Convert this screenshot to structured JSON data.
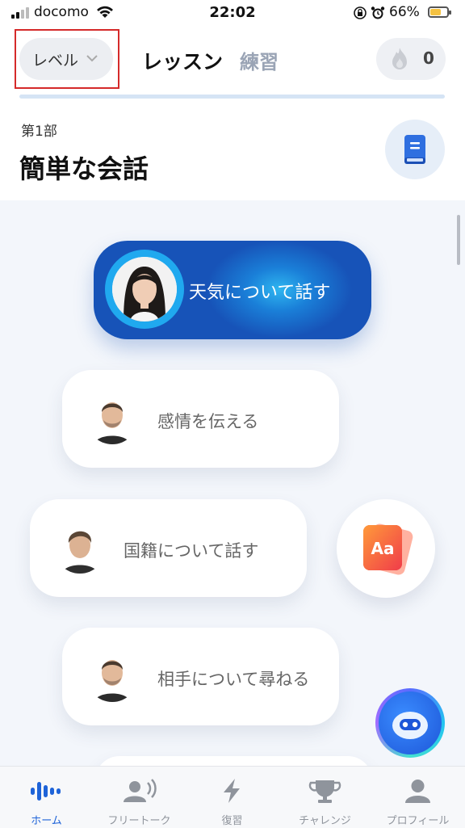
{
  "status_bar": {
    "carrier": "docomo",
    "time": "22:02",
    "battery_percent": "66%",
    "battery_level": 0.66,
    "icons": [
      "signal-icon",
      "wifi-icon",
      "orientation-lock-icon",
      "alarm-icon",
      "battery-icon"
    ]
  },
  "header": {
    "level_label": "レベル",
    "tabs": [
      "レッスン",
      "練習"
    ],
    "active_tab": "レッスン",
    "streak_count": "0",
    "highlight_color": "#d52a2a"
  },
  "section": {
    "part_label": "第1部",
    "title": "簡単な会話"
  },
  "lessons": [
    {
      "title": "天気について話す",
      "active": true
    },
    {
      "title": "感情を伝える",
      "active": false
    },
    {
      "title": "国籍について話す",
      "active": false
    },
    {
      "title": "相手について尋ねる",
      "active": false
    }
  ],
  "vocab_button_text": "Aa",
  "tab_bar": {
    "items": [
      {
        "label": "ホーム",
        "icon": "voice-wave-icon",
        "active": true
      },
      {
        "label": "フリートーク",
        "icon": "speaking-person-icon",
        "active": false
      },
      {
        "label": "復習",
        "icon": "lightning-icon",
        "active": false
      },
      {
        "label": "チャレンジ",
        "icon": "trophy-icon",
        "active": false
      },
      {
        "label": "プロフィール",
        "icon": "person-icon",
        "active": false
      }
    ]
  },
  "colors": {
    "accent": "#1e63d8",
    "active_lesson_gradient": [
      "#2fb6f0",
      "#1753b8"
    ]
  }
}
